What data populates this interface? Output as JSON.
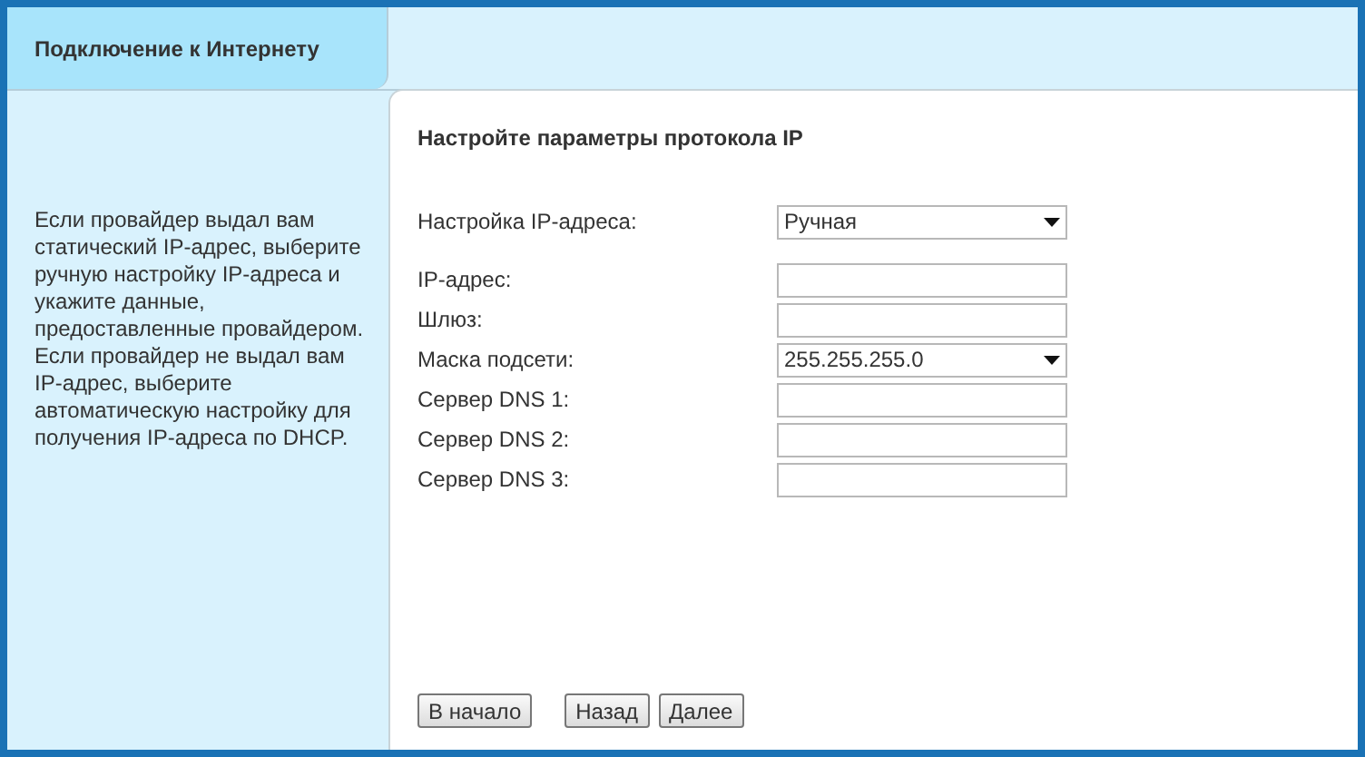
{
  "tab": {
    "label": "Подключение к Интернету",
    "selected": true
  },
  "help_text": "Если провайдер выдал вам статический IP-адрес, выберите ручную настройку IP-адреса и укажите данные, предоставленные провайдером. Если провайдер не выдал вам IP-адрес, выберите автоматическую настройку для получения IP-адреса по DHCP.",
  "form": {
    "title": "Настройте параметры протокола IP",
    "fields": [
      {
        "label": "Настройка IP-адреса:",
        "kind": "select",
        "value": "Ручная"
      },
      {
        "label": "IP-адрес:",
        "kind": "text"
      },
      {
        "label": "Шлюз:",
        "kind": "text"
      },
      {
        "label": "Маска подсети:",
        "kind": "select",
        "value": "255.255.255.0"
      },
      {
        "label": "Сервер DNS 1:",
        "kind": "text"
      },
      {
        "label": "Сервер DNS 2:",
        "kind": "text"
      },
      {
        "label": "Сервер DNS 3:",
        "kind": "text"
      }
    ]
  },
  "buttons": [
    "В начало",
    "Назад",
    "Далее"
  ]
}
